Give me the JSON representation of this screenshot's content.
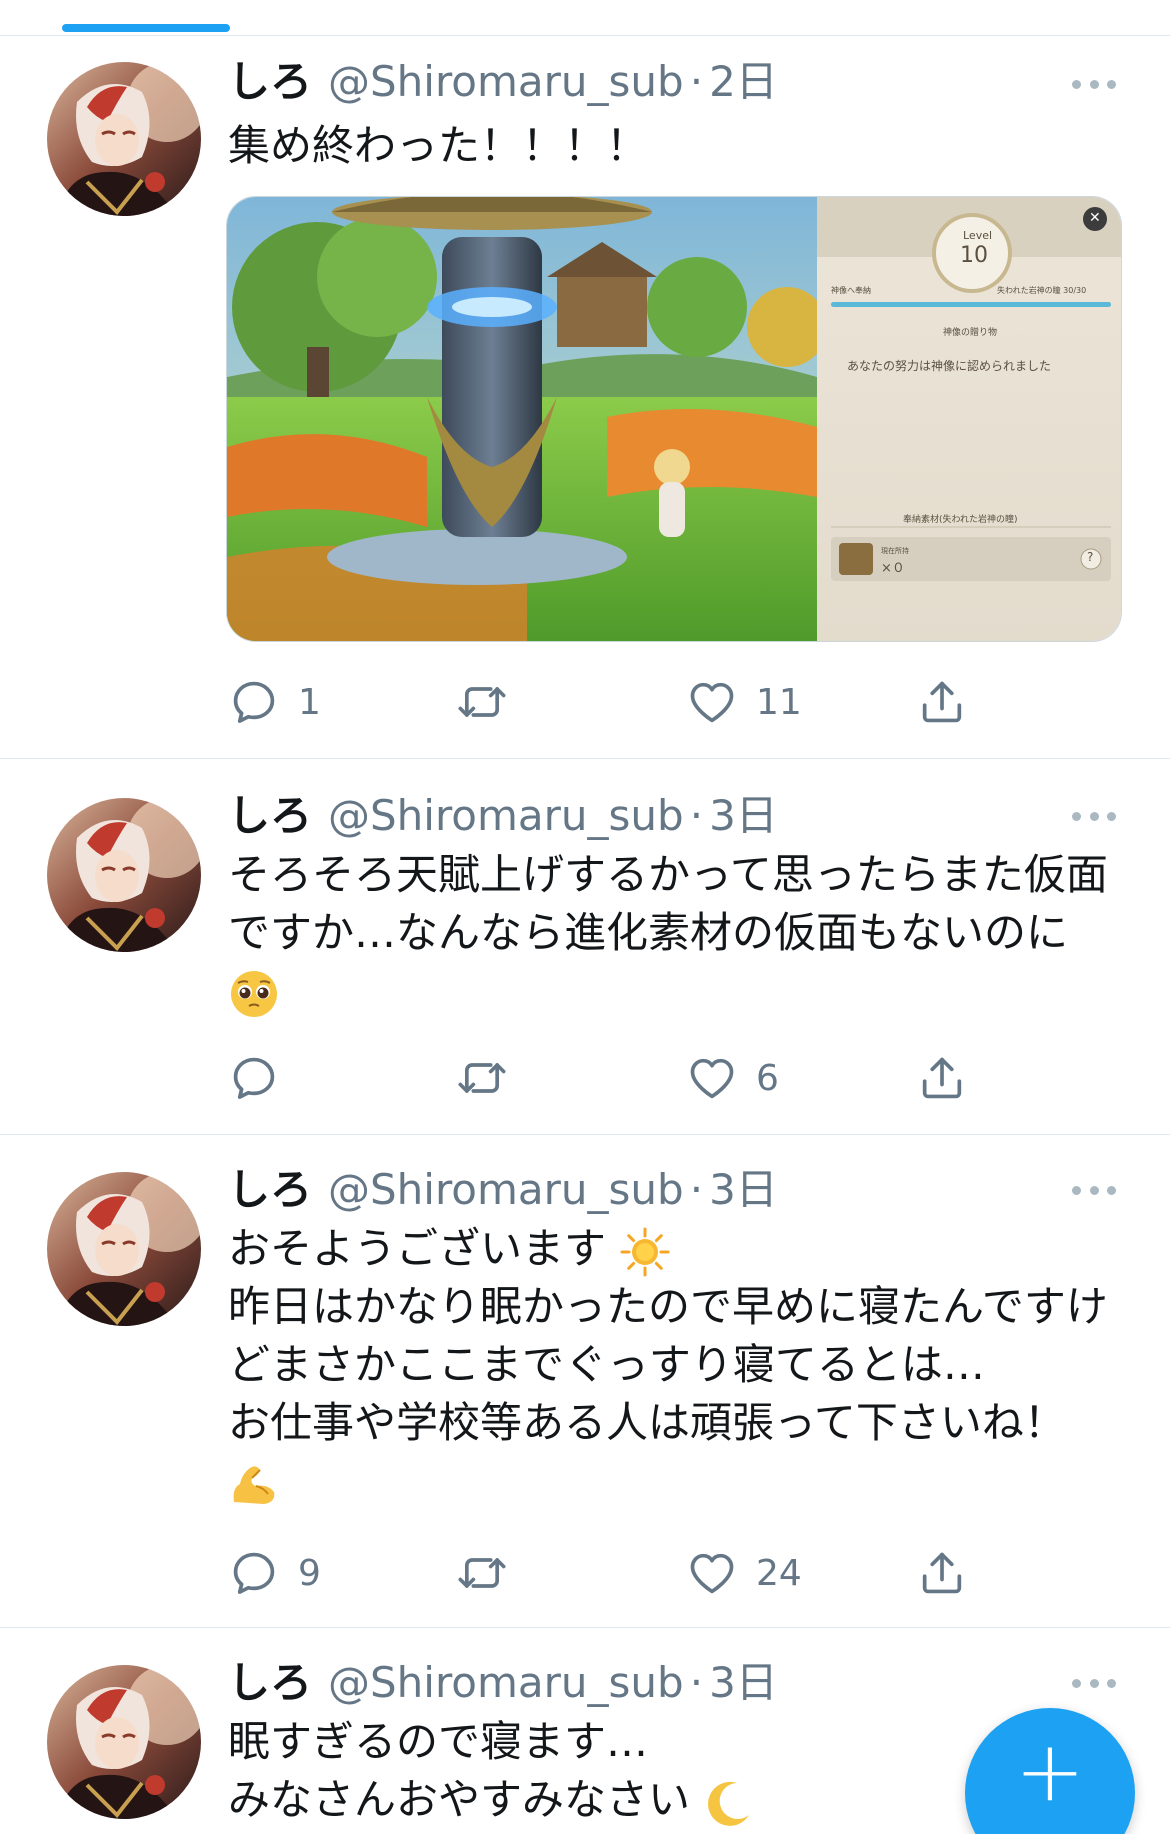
{
  "colors": {
    "accent": "#1da1f2",
    "muted": "#657786",
    "divider": "#e1e8ed"
  },
  "fab": {
    "label": "+"
  },
  "tweets": [
    {
      "name": "しろ",
      "handle": "@Shiromaru_sub",
      "sep": "·",
      "time": "2日",
      "lines": [
        "集め終わった！！！！"
      ],
      "media": {
        "level_label": "Level",
        "level_value": "10",
        "progress_left": "神像へ奉納",
        "progress_right": "失われた岩神の瞳 30/30",
        "progress_fraction": 1.0,
        "gift_title": "神像の贈り物",
        "message": "あなたの努力は神像に認められました",
        "material_title": "奉納素材(失われた岩神の瞳)",
        "owned_label": "現在所持",
        "owned_count": "×０",
        "help": "?",
        "close": "✕"
      },
      "replies": "1",
      "likes": "11"
    },
    {
      "name": "しろ",
      "handle": "@Shiromaru_sub",
      "sep": "·",
      "time": "3日",
      "lines": [
        "そろそろ天賦上げするかって思ったらまた仮面",
        "ですか…なんなら進化素材の仮面もないのに"
      ],
      "emoji": "pleading-face",
      "replies": "",
      "likes": "6"
    },
    {
      "name": "しろ",
      "handle": "@Shiromaru_sub",
      "sep": "·",
      "time": "3日",
      "lines": [
        "おそようございます",
        "昨日はかなり眠かったので早めに寝たんですけ",
        "どまさかここまでぐっすり寝てるとは…",
        "お仕事や学校等ある人は頑張って下さいね！"
      ],
      "emoji_inline": "sun",
      "emoji": "flexed-biceps",
      "replies": "9",
      "likes": "24"
    },
    {
      "name": "しろ",
      "handle": "@Shiromaru_sub",
      "sep": "·",
      "time": "3日",
      "lines": [
        "眠すぎるので寝ます…",
        "みなさんおやすみなさい"
      ],
      "emoji_inline": "crescent-moon"
    }
  ]
}
